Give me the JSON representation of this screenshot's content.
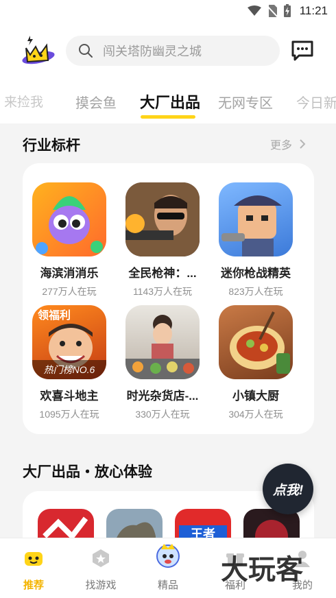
{
  "status_bar": {
    "time": "11:21"
  },
  "search": {
    "placeholder": "闯关塔防幽灵之城"
  },
  "tabs": [
    {
      "label": "来捡我"
    },
    {
      "label": "摸会鱼"
    },
    {
      "label": "大厂出品"
    },
    {
      "label": "无网专区"
    },
    {
      "label": "今日新"
    }
  ],
  "section1": {
    "title": "行业标杆",
    "more": "更多",
    "games": [
      {
        "name": "海滨消消乐",
        "players": "277万人在玩"
      },
      {
        "name": "全民枪神：...",
        "players": "1143万人在玩"
      },
      {
        "name": "迷你枪战精英",
        "players": "823万人在玩"
      },
      {
        "name": "欢喜斗地主",
        "players": "1095万人在玩",
        "badge": "热门榜NO.6",
        "icon_text": "领福利"
      },
      {
        "name": "时光杂货店-...",
        "players": "330万人在玩"
      },
      {
        "name": "小镇大厨",
        "players": "304万人在玩"
      }
    ]
  },
  "section2": {
    "title": "大厂出品・放心体验",
    "preview_text": "王者"
  },
  "float_button": {
    "label": "点我!"
  },
  "bottom_nav": [
    {
      "label": "推荐"
    },
    {
      "label": "找游戏"
    },
    {
      "label": "精品"
    },
    {
      "label": "福利"
    },
    {
      "label": "我的"
    }
  ],
  "watermark": "大玩客",
  "colors": {
    "accent": "#ffd418",
    "active_nav": "#f4b400"
  }
}
